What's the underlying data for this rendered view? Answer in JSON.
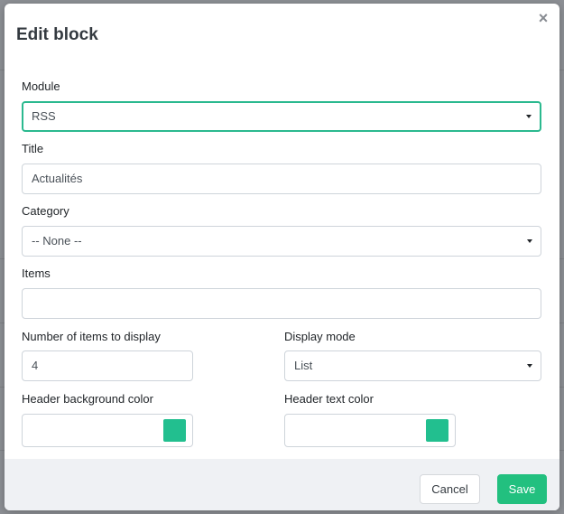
{
  "modal": {
    "title": "Edit block",
    "close_glyph": "×",
    "close_icon": "close-icon"
  },
  "form": {
    "module": {
      "label": "Module",
      "value": "RSS"
    },
    "title": {
      "label": "Title",
      "value": "Actualités"
    },
    "category": {
      "label": "Category",
      "value": "-- None --"
    },
    "items": {
      "label": "Items",
      "value": ""
    },
    "num_items": {
      "label": "Number of items to display",
      "value": "4"
    },
    "display_mode": {
      "label": "Display mode",
      "value": "List"
    },
    "header_bg_color": {
      "label": "Header background color",
      "value": "",
      "swatch_color": "#22bf8f"
    },
    "header_text_color": {
      "label": "Header text color",
      "value": "",
      "swatch_color": "#22bf8f"
    }
  },
  "footer": {
    "cancel_label": "Cancel",
    "save_label": "Save"
  },
  "colors": {
    "accent": "#22c07f",
    "focus_border": "#2bb98f"
  }
}
